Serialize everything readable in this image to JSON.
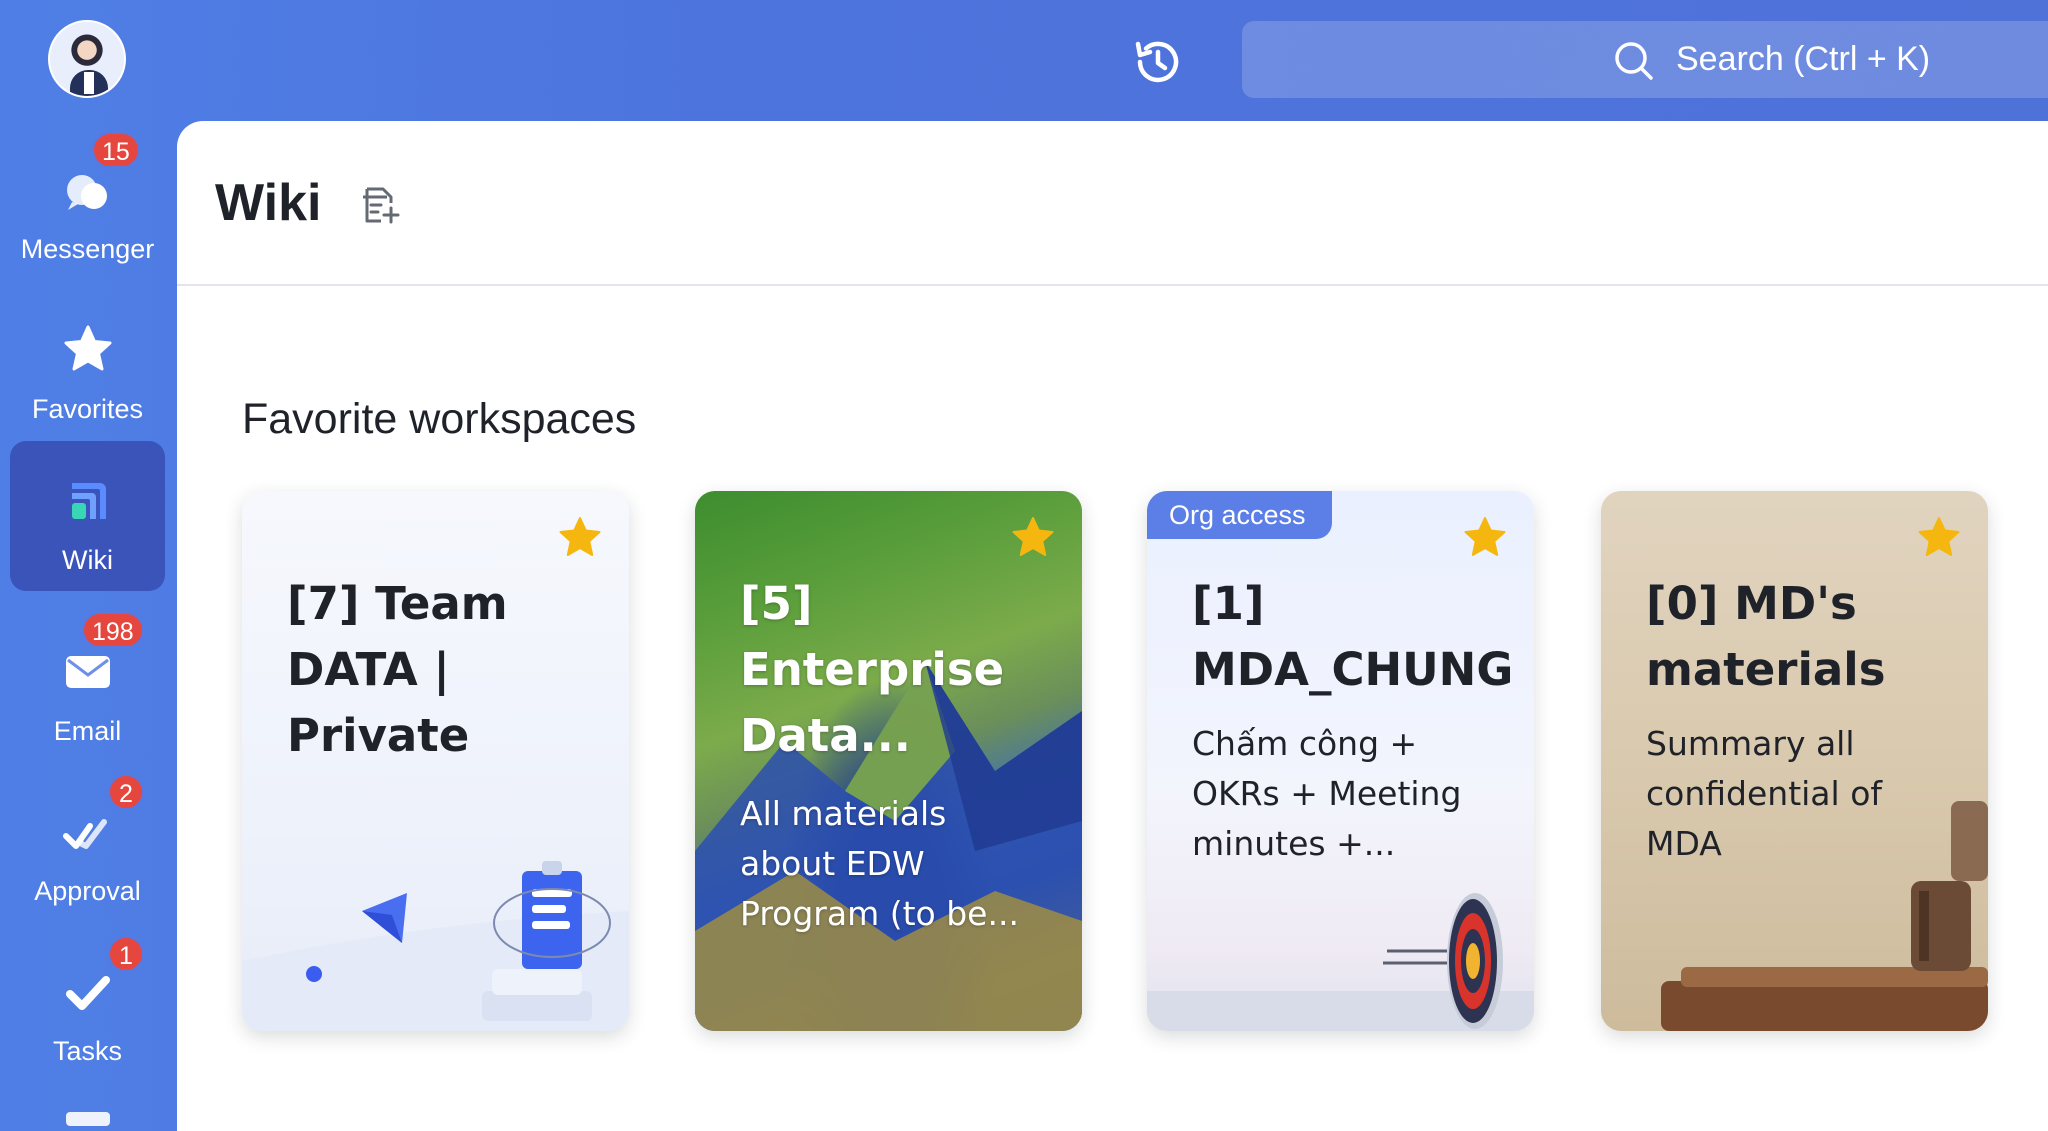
{
  "rail": {
    "items": [
      {
        "label": "Messenger",
        "badge": "15"
      },
      {
        "label": "Favorites",
        "badge": ""
      },
      {
        "label": "Wiki",
        "badge": ""
      },
      {
        "label": "Email",
        "badge": "198"
      },
      {
        "label": "Approval",
        "badge": "2"
      },
      {
        "label": "Tasks",
        "badge": "1"
      }
    ],
    "active": "Wiki"
  },
  "topbar": {
    "search_placeholder": "Search (Ctrl + K)"
  },
  "page": {
    "title": "Wiki",
    "section_title": "Favorite workspaces"
  },
  "cards": [
    {
      "title": "[7] Team DATA | Private",
      "description": "",
      "tag": "",
      "starred": true
    },
    {
      "title": "[5] Enterprise Data...",
      "description": "All materials about EDW Program (to be...",
      "tag": "",
      "starred": true
    },
    {
      "title": "[1] MDA_CHUNG",
      "description": "Chấm công + OKRs + Meeting minutes +...",
      "tag": "Org access",
      "starred": true
    },
    {
      "title": "[0] MD's materials",
      "description": "Summary all confidential of MDA",
      "tag": "",
      "starred": true
    }
  ],
  "colors": {
    "brand": "#4f72d9",
    "active_nav": "#3b54b9",
    "badge": "#e5463e",
    "star": "#f5b70f",
    "org_tag": "#5b7fe6"
  },
  "icons": {
    "history": "history-icon",
    "search": "search-icon",
    "wiki_action": "new-doc-icon",
    "star": "star-icon"
  }
}
